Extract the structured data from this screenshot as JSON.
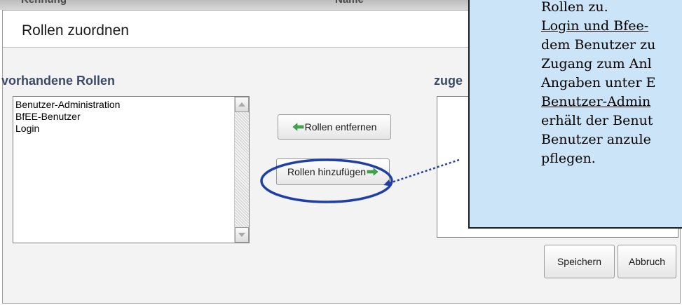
{
  "background_strip": {
    "left_text": "Kennung",
    "right_text": "Name"
  },
  "dialog": {
    "title": "Rollen zuordnen",
    "left_section_label": "vorhandene Rollen",
    "right_section_label": "zuge",
    "available_roles": [
      "Benutzer-Administration",
      "BfEE-Benutzer",
      "Login"
    ],
    "buttons": {
      "remove_roles": "Rollen entfernen",
      "add_roles": "Rollen hinzufügen",
      "save": "Speichern",
      "cancel": "Abbruch"
    }
  },
  "callout": {
    "lines": [
      {
        "text": "Rollen zu.",
        "underline": false
      },
      {
        "text": "Login und Bfee-",
        "underline": true
      },
      {
        "text": "dem Benutzer zu",
        "underline": false
      },
      {
        "text": "Zugang zum Anl",
        "underline": false
      },
      {
        "text": "Angaben unter E",
        "underline": false
      },
      {
        "text": "Benutzer-Admin",
        "underline": true
      },
      {
        "text": "erhält der Benut",
        "underline": false
      },
      {
        "text": "Benutzer anzule",
        "underline": false
      },
      {
        "text": "pflegen.",
        "underline": false
      }
    ]
  },
  "colors": {
    "callout_background": "#cce4f7",
    "annotation_blue": "#1f3fa7",
    "arrow_green": "#3ea84a",
    "section_label": "#3d4a66"
  },
  "icons": {
    "remove_roles_icon": "arrow-left-green-icon",
    "add_roles_icon": "arrow-right-green-icon"
  }
}
